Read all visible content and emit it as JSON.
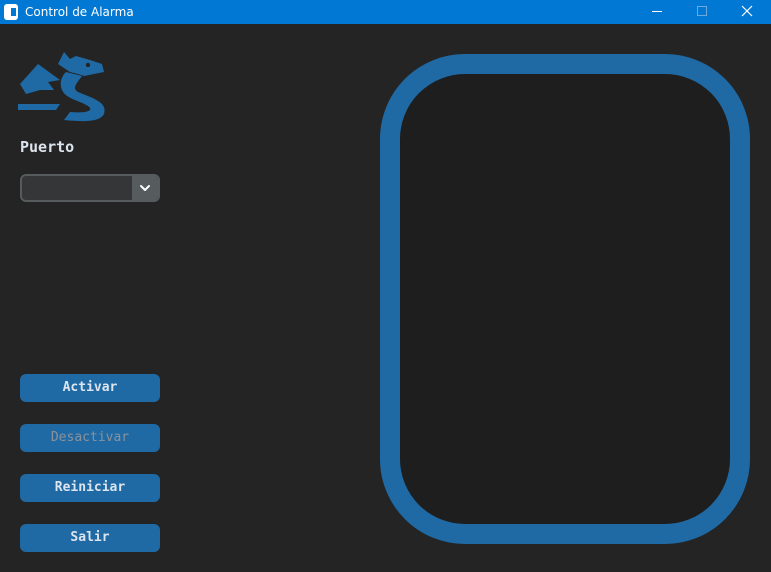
{
  "window": {
    "title": "Control de Alarma",
    "title_bar_color": "#0078d4"
  },
  "window_controls": [
    {
      "name": "minimize",
      "icon": "minimize-icon"
    },
    {
      "name": "maximize",
      "icon": "maximize-icon"
    },
    {
      "name": "close",
      "icon": "close-icon"
    }
  ],
  "logo": {
    "icon": "dragon-logo-icon",
    "color": "#1f6aa5"
  },
  "port": {
    "label": "Puerto",
    "selected_value": "",
    "dropdown_icon": "chevron-down-icon"
  },
  "buttons": {
    "activate": {
      "label": "Activar",
      "enabled": true
    },
    "deactivate": {
      "label": "Desactivar",
      "enabled": false
    },
    "restart": {
      "label": "Reiniciar",
      "enabled": true
    },
    "exit": {
      "label": "Salir",
      "enabled": true
    }
  },
  "indicator": {
    "border_color": "#1f6aa5",
    "fill_color": "#1e1e1e"
  },
  "colors": {
    "background": "#242424",
    "accent": "#1f6aa5",
    "text": "#dce4ee",
    "disabled_text": "#8b9299"
  }
}
